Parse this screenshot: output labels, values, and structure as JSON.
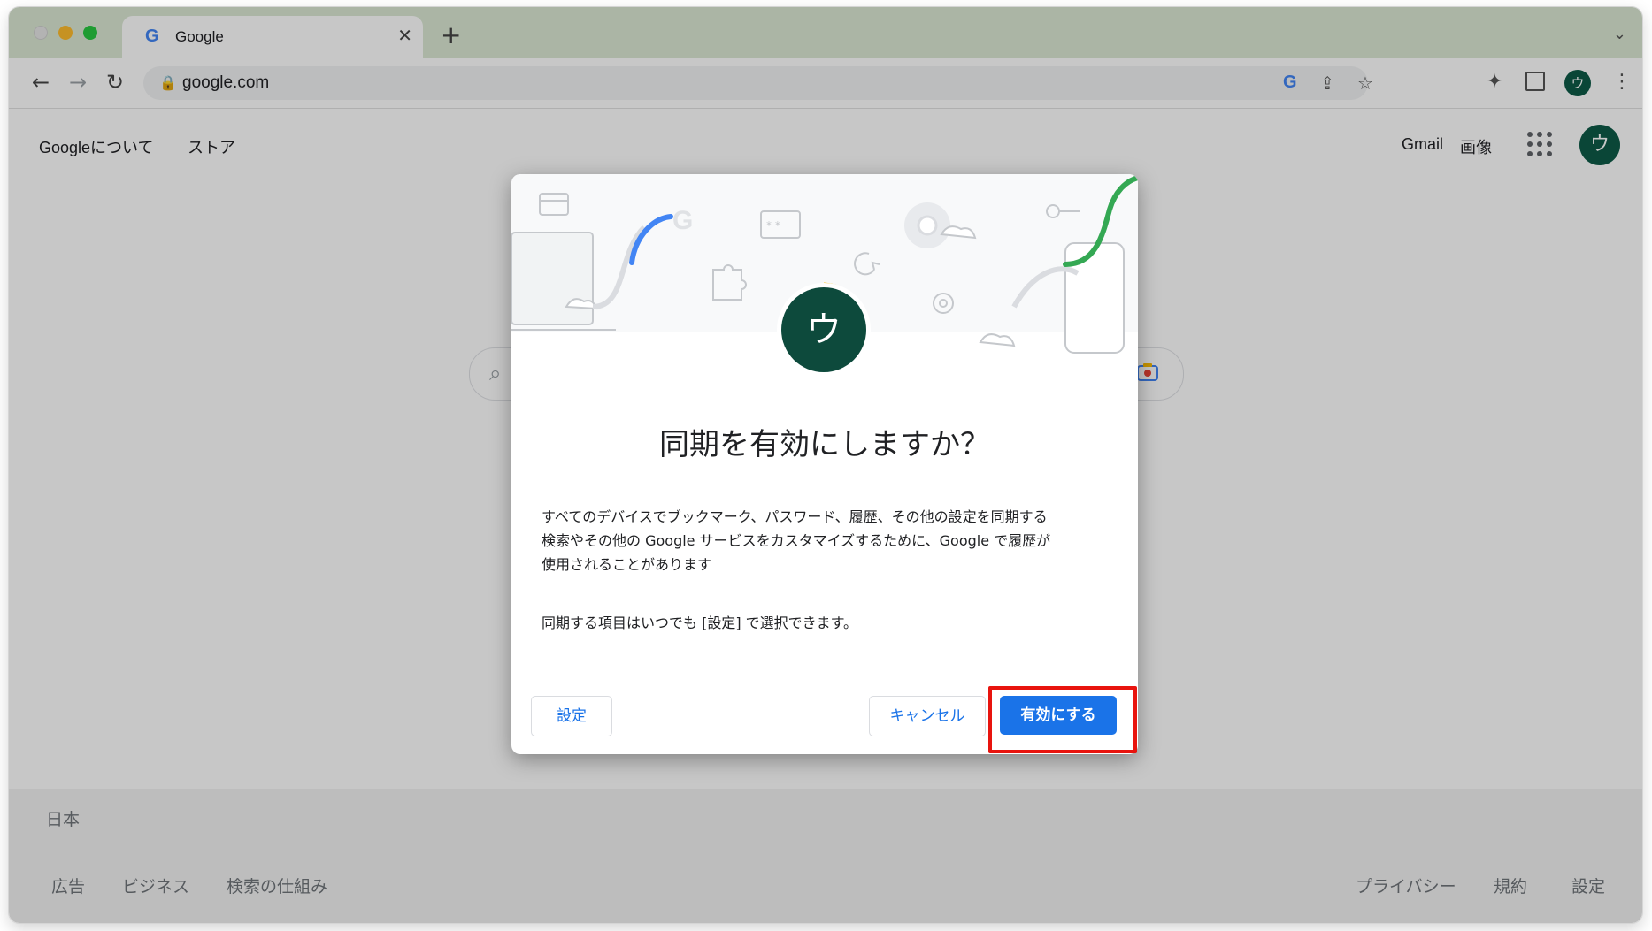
{
  "tab": {
    "title": "Google",
    "favicon": "G"
  },
  "toolbar": {
    "url": "google.com"
  },
  "page": {
    "nav_left": [
      "Googleについて",
      "ストア"
    ],
    "nav_right": [
      "Gmail",
      "画像"
    ],
    "avatar_letter": "ウ"
  },
  "footer": {
    "country": "日本",
    "left_links": [
      "広告",
      "ビジネス",
      "検索の仕組み"
    ],
    "right_links": [
      "プライバシー",
      "規約",
      "設定"
    ]
  },
  "dialog": {
    "avatar_letter": "ウ",
    "title": "同期を有効にしますか？",
    "body_line1": "すべてのデバイスでブックマーク、パスワード、履歴、その他の設定を同期する",
    "body_line2": "検索やその他の Google サービスをカスタマイズするために、Google で履歴が",
    "body_line3": "使用されることがあります",
    "body_note": "同期する項目はいつでも [設定] で選択できます。",
    "settings_label": "設定",
    "cancel_label": "キャンセル",
    "enable_label": "有効にする"
  },
  "colors": {
    "accent": "#1a73e8",
    "avatar": "#0d4a3c",
    "highlight": "#e8140e",
    "tabstrip": "#dbe8d4"
  }
}
